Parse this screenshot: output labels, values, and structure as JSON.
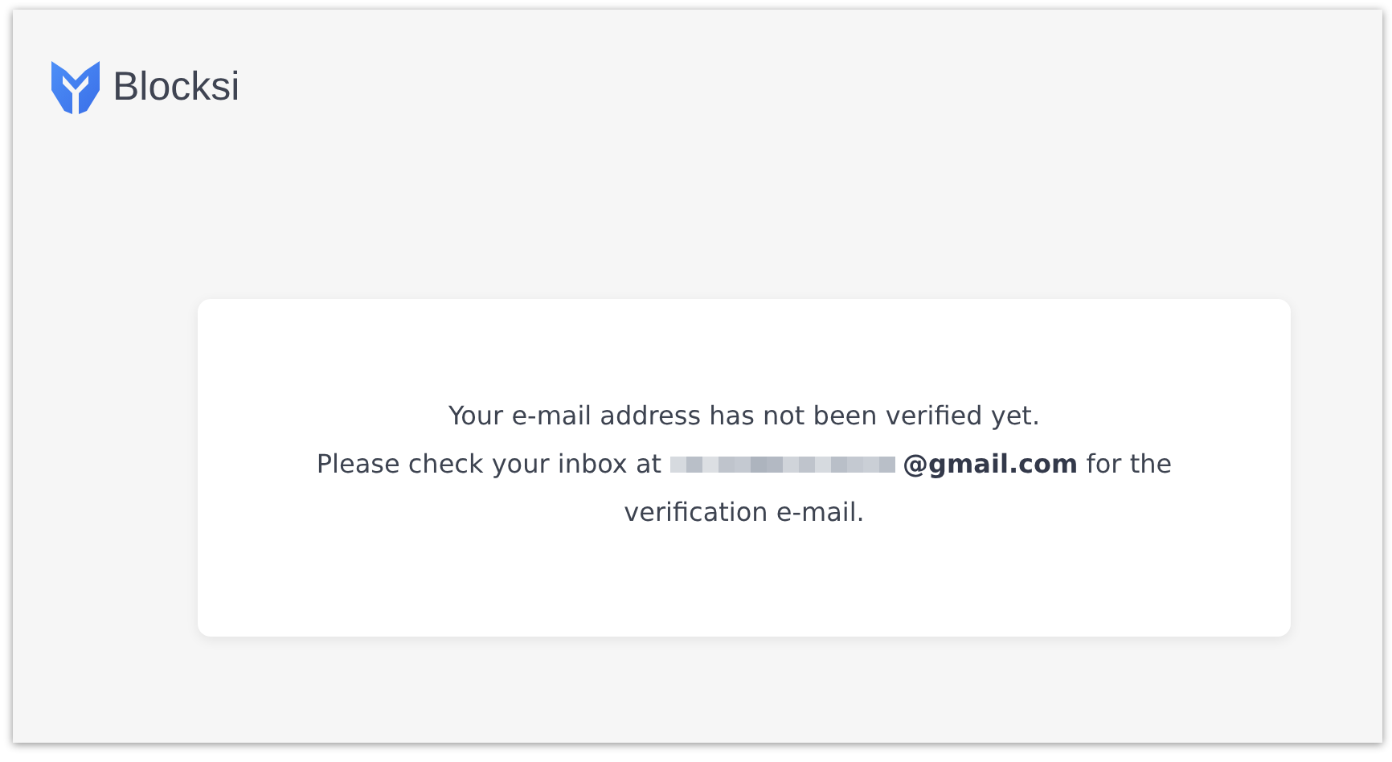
{
  "brand": {
    "name": "Blocksi"
  },
  "message": {
    "line_1": "Your e-mail address has not been verified yet.",
    "line_2_start": "Please check your inbox at",
    "line_2_end": "**@gmail.com** for the",
    "line_3": "verification e-mail."
  }
}
